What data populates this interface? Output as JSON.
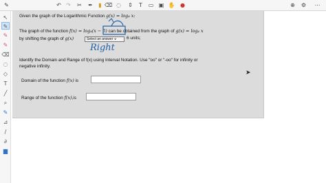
{
  "toolbar": {
    "icons": [
      "edit-icon",
      "undo-icon",
      "redo-icon",
      "cut-icon",
      "pen-icon",
      "highlighter-icon",
      "eraser-icon",
      "lasso-icon",
      "insert-space-icon",
      "text-icon",
      "shapes-icon",
      "image-icon",
      "hand-icon",
      "laser-icon",
      "zoom-icon",
      "settings-icon",
      "more-icon"
    ]
  },
  "question": {
    "title_text": "Given the graph of the Logarithmic Function",
    "title_math": "g(x) = log₄ x:",
    "line1_a": "The graph of the function",
    "line1_f": "f(x) = log₄",
    "line1_arg": "(x − 6)",
    "line1_b": "can be obtained from the graph of",
    "line1_g": "g(x) = log₄ x",
    "line2_a": "by shifting the graph of",
    "line2_g": "g(x)",
    "select_label": "Select an answer ∨",
    "line2_b": "6 units;",
    "handwritten_answer": "Right",
    "instr1": "Identify the Domain and Range of f(x) using Interval Notation. Use \"oo\" or \"-oo\" for infinity or",
    "instr2": "negative infinity.",
    "domain_label": "Domain of the function",
    "domain_f": "f(x)",
    "domain_is": "is",
    "domain_value": "",
    "range_label": "Range of the function",
    "range_f": "f(x)",
    "range_is": ",is",
    "range_value": ""
  },
  "colors": {
    "panel_bg": "#dcdcdc",
    "annotation_blue": "#1f5fa8"
  }
}
